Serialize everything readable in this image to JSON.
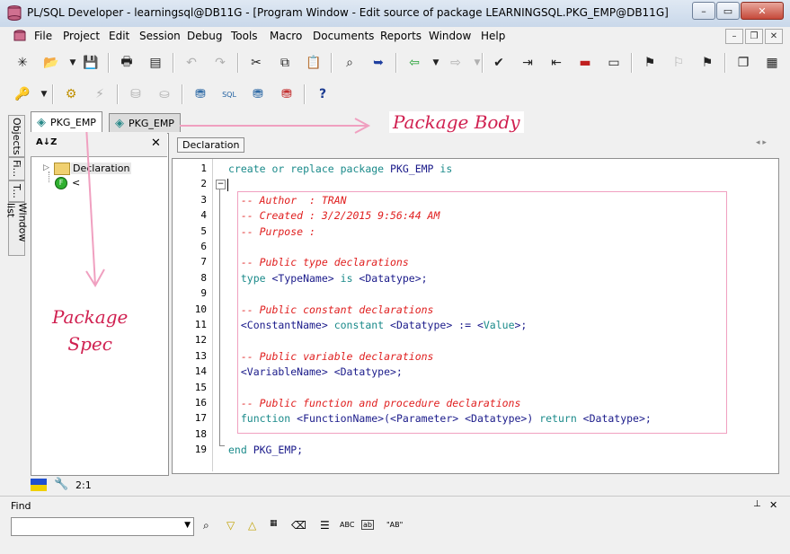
{
  "window": {
    "title": "PL/SQL Developer - learningsql@DB11G - [Program Window - Edit source of package LEARNINGSQL.PKG_EMP@DB11G]",
    "controls": {
      "minimize": "–",
      "maximize": "▭",
      "close": "✕"
    }
  },
  "menu": [
    "File",
    "Project",
    "Edit",
    "Session",
    "Debug",
    "Tools",
    "Macro",
    "Documents",
    "Reports",
    "Window",
    "Help"
  ],
  "mdi_controls": {
    "minimize": "–",
    "restore": "❐",
    "close": "✕"
  },
  "side_tabs": [
    "Objects",
    "Fi...",
    "T...",
    "Window list"
  ],
  "doc_tabs": [
    {
      "label": "PKG_EMP",
      "active": true
    },
    {
      "label": "PKG_EMP",
      "active": false
    }
  ],
  "left_panel": {
    "sort_icon": "A↓Z",
    "close": "✕",
    "tree": [
      {
        "label": "Declaration"
      },
      {
        "label": "<"
      }
    ]
  },
  "editor": {
    "section_button": "Declaration",
    "lines": [
      {
        "n": "1",
        "segs": [
          [
            "kw",
            "create or replace package"
          ],
          [
            "bl",
            " PKG_EMP "
          ],
          [
            "kw",
            "is"
          ]
        ]
      },
      {
        "n": "2",
        "segs": []
      },
      {
        "n": "3",
        "segs": [
          [
            "cm",
            "  -- Author  : TRAN"
          ]
        ]
      },
      {
        "n": "4",
        "segs": [
          [
            "cm",
            "  -- Created : 3/2/2015 9:56:44 AM"
          ]
        ]
      },
      {
        "n": "5",
        "segs": [
          [
            "cm",
            "  -- Purpose : "
          ]
        ]
      },
      {
        "n": "6",
        "segs": []
      },
      {
        "n": "7",
        "segs": [
          [
            "cm",
            "  -- Public type declarations"
          ]
        ]
      },
      {
        "n": "8",
        "segs": [
          [
            "kw",
            "  type"
          ],
          [
            "bl",
            " <TypeName> "
          ],
          [
            "kw",
            "is"
          ],
          [
            "bl",
            " <Datatype>;"
          ]
        ]
      },
      {
        "n": "9",
        "segs": []
      },
      {
        "n": "10",
        "segs": [
          [
            "cm",
            "  -- Public constant declarations"
          ]
        ]
      },
      {
        "n": "11",
        "segs": [
          [
            "bl",
            "  <ConstantName> "
          ],
          [
            "kw",
            "constant"
          ],
          [
            "bl",
            " <Datatype> := <"
          ],
          [
            "kw",
            "Value"
          ],
          [
            "bl",
            ">;"
          ]
        ]
      },
      {
        "n": "12",
        "segs": []
      },
      {
        "n": "13",
        "segs": [
          [
            "cm",
            "  -- Public variable declarations"
          ]
        ]
      },
      {
        "n": "14",
        "segs": [
          [
            "bl",
            "  <VariableName> <Datatype>;"
          ]
        ]
      },
      {
        "n": "15",
        "segs": []
      },
      {
        "n": "16",
        "segs": [
          [
            "cm",
            "  -- Public function and procedure declarations"
          ]
        ]
      },
      {
        "n": "17",
        "segs": [
          [
            "kw",
            "  function"
          ],
          [
            "bl",
            " <FunctionName>(<Parameter> <Datatype>) "
          ],
          [
            "kw",
            "return"
          ],
          [
            "bl",
            " <Datatype>;"
          ]
        ]
      },
      {
        "n": "18",
        "segs": []
      },
      {
        "n": "19",
        "segs": [
          [
            "kw",
            "end"
          ],
          [
            "bl",
            " PKG_EMP;"
          ]
        ]
      }
    ]
  },
  "status": {
    "position": "2:1"
  },
  "find": {
    "label": "Find",
    "pin": "📌",
    "close": "✕",
    "input_value": "",
    "tools": [
      "binoculars",
      "▽",
      "△",
      "ABC-hl",
      "eraser",
      "☰",
      "ABC",
      "ab-box",
      "\"AB\""
    ]
  },
  "annotations": {
    "package_body": "Package Body",
    "package_spec": "Package\nSpec"
  }
}
